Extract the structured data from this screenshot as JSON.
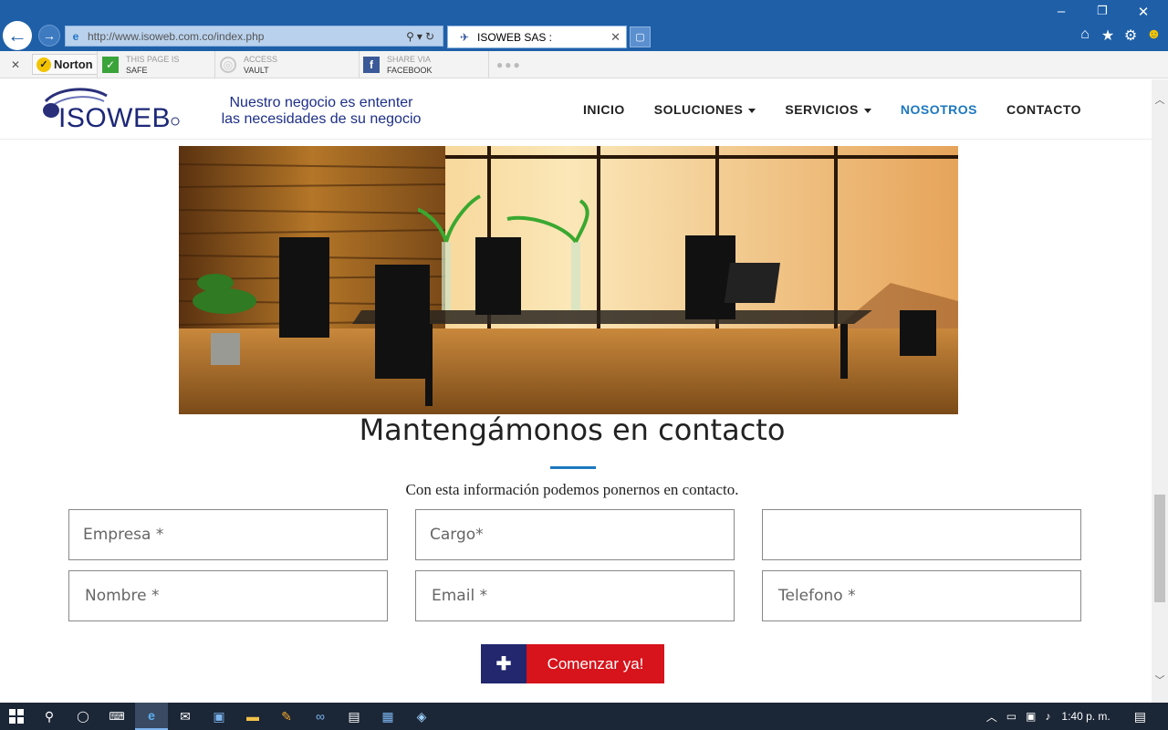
{
  "browser": {
    "url": "http://www.isoweb.com.co/index.php",
    "tab_title": "ISOWEB SAS  :",
    "tab_close": "✕",
    "back_glyph": "←",
    "forward_glyph": "→",
    "window_controls": [
      "‒",
      "❐",
      "✕"
    ],
    "icons": [
      "home-icon",
      "favorites-star-icon",
      "tools-gear-icon",
      "feedback-smiley-icon"
    ]
  },
  "toolbar": {
    "close_glyph": "✕",
    "norton_label": "Norton",
    "items": [
      {
        "line1": "THIS PAGE IS",
        "line2": "SAFE",
        "icon": "green-check-icon",
        "color": "#3aa33a"
      },
      {
        "line1": "ACCESS",
        "line2": "VAULT",
        "icon": "vault-icon",
        "color": "#c8c8c8"
      },
      {
        "line1": "SHARE VIA",
        "line2": "FACEBOOK",
        "icon": "facebook-icon",
        "color": "#3b5998"
      }
    ],
    "more": "●●●"
  },
  "site": {
    "logo_text": "ISOWEB",
    "tagline_line1": "Nuestro negocio es ententer",
    "tagline_line2": "las necesidades de su negocio",
    "menu": [
      {
        "label": "INICIO",
        "dropdown": false,
        "active": false
      },
      {
        "label": "SOLUCIONES",
        "dropdown": true,
        "active": false
      },
      {
        "label": "SERVICIOS",
        "dropdown": true,
        "active": false
      },
      {
        "label": "NOSOTROS",
        "dropdown": false,
        "active": true
      },
      {
        "label": "CONTACTO",
        "dropdown": false,
        "active": false
      }
    ],
    "accent_color": "#1d78bf"
  },
  "contact": {
    "title": "Mantengámonos en contacto",
    "subtitle": "Con esta información podemos ponernos en contacto.",
    "fields": {
      "empresa": "Empresa *",
      "cargo": "Cargo*",
      "extra": "",
      "nombre": "Nombre *",
      "email": "Email *",
      "telefono": "Telefono *"
    },
    "cta_icon": "✚",
    "cta_label": "Comenzar ya!"
  },
  "taskbar": {
    "clock": "1:40 p. m.",
    "apps": [
      "start-icon",
      "search-icon",
      "cortana-icon",
      "keyboard-icon",
      "internet-explorer-icon",
      "mail-icon",
      "app-icon",
      "file-explorer-icon",
      "app-icon",
      "link-icon",
      "app-icon",
      "app-icon",
      "app-icon"
    ]
  }
}
